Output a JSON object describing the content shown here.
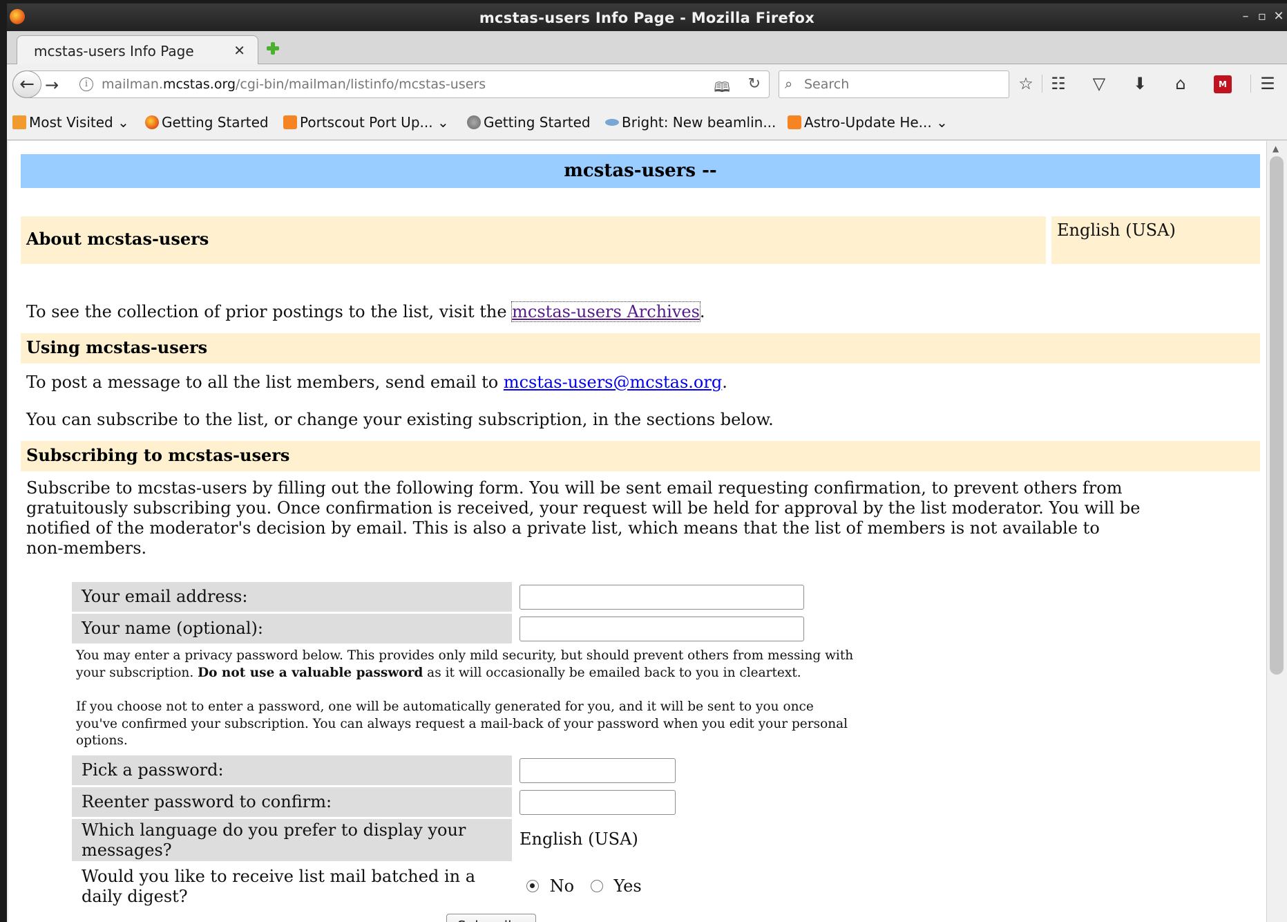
{
  "window": {
    "title": "mcstas-users Info Page - Mozilla Firefox",
    "controls": {
      "minimize": "–",
      "maximize": "▫",
      "close": "✕"
    }
  },
  "tabs": [
    {
      "label": "mcstas-users Info Page",
      "close": "✕",
      "active": true
    }
  ],
  "navbar": {
    "url_prefix": "mailman.",
    "url_domain": "mcstas.org",
    "url_path": "/cgi-bin/mailman/listinfo/mcstas-users",
    "search_placeholder": "Search"
  },
  "bookmarks": [
    {
      "label": "Most Visited",
      "icon": "folder-icon",
      "dropdown": true
    },
    {
      "label": "Getting Started",
      "icon": "firefox-icon",
      "dropdown": false
    },
    {
      "label": "Portscout Port Up...",
      "icon": "rss-icon",
      "dropdown": true
    },
    {
      "label": "Getting Started",
      "icon": "globe-icon",
      "dropdown": false
    },
    {
      "label": "Bright: New beamlin...",
      "icon": "bright-icon",
      "dropdown": false
    },
    {
      "label": "Astro-Update He...",
      "icon": "rss-icon",
      "dropdown": true
    }
  ],
  "page": {
    "banner_title": "mcstas-users --",
    "about_heading": "About mcstas-users",
    "language": "English (USA)",
    "archive_text_before": "To see the collection of prior postings to the list, visit the ",
    "archive_link": "mcstas-users Archives",
    "archive_text_after": ".",
    "using_heading": "Using mcstas-users",
    "post_text_before": "To post a message to all the list members, send email to ",
    "post_email": "mcstas-users@mcstas.org",
    "post_text_after": ".",
    "subscribe_intro": "You can subscribe to the list, or change your existing subscription, in the sections below.",
    "subscribing_heading": "Subscribing to mcstas-users",
    "subscribe_text_lines": [
      "Subscribe to mcstas-users by filling out the following form. You will be sent email requesting confirmation, to prevent others from",
      "gratuitously subscribing you. Once confirmation is received, your request will be held for approval by the list moderator. You will be",
      "notified of the moderator's decision by email. This is also a private list, which means that the list of members is not available to",
      "non-members."
    ]
  },
  "form": {
    "email_label": "Your email address:",
    "name_label": "Your name (optional):",
    "privacy_line1": "You may enter a privacy password below. This provides only mild security, but should prevent others from messing with",
    "privacy_line2_before": "your subscription. ",
    "privacy_line2_bold": "Do not use a valuable password",
    "privacy_line2_after": " as it will occasionally be emailed back to you in cleartext.",
    "auto_pw_lines": [
      "If you choose not to enter a password, one will be automatically generated for you, and it will be sent to you once",
      "you've confirmed your subscription. You can always request a mail-back of your password when you edit your personal",
      "options."
    ],
    "password_label": "Pick a password:",
    "password_confirm_label": "Reenter password to confirm:",
    "language_question_lines": [
      "Which language do you prefer to display your",
      "messages?"
    ],
    "language_value": "English (USA)",
    "digest_question_lines": [
      "Would you like to receive list mail batched in a",
      "daily digest?"
    ],
    "digest_no": "No",
    "digest_yes": "Yes",
    "digest_selected": "No",
    "subscribe_button": "Subscribe"
  }
}
